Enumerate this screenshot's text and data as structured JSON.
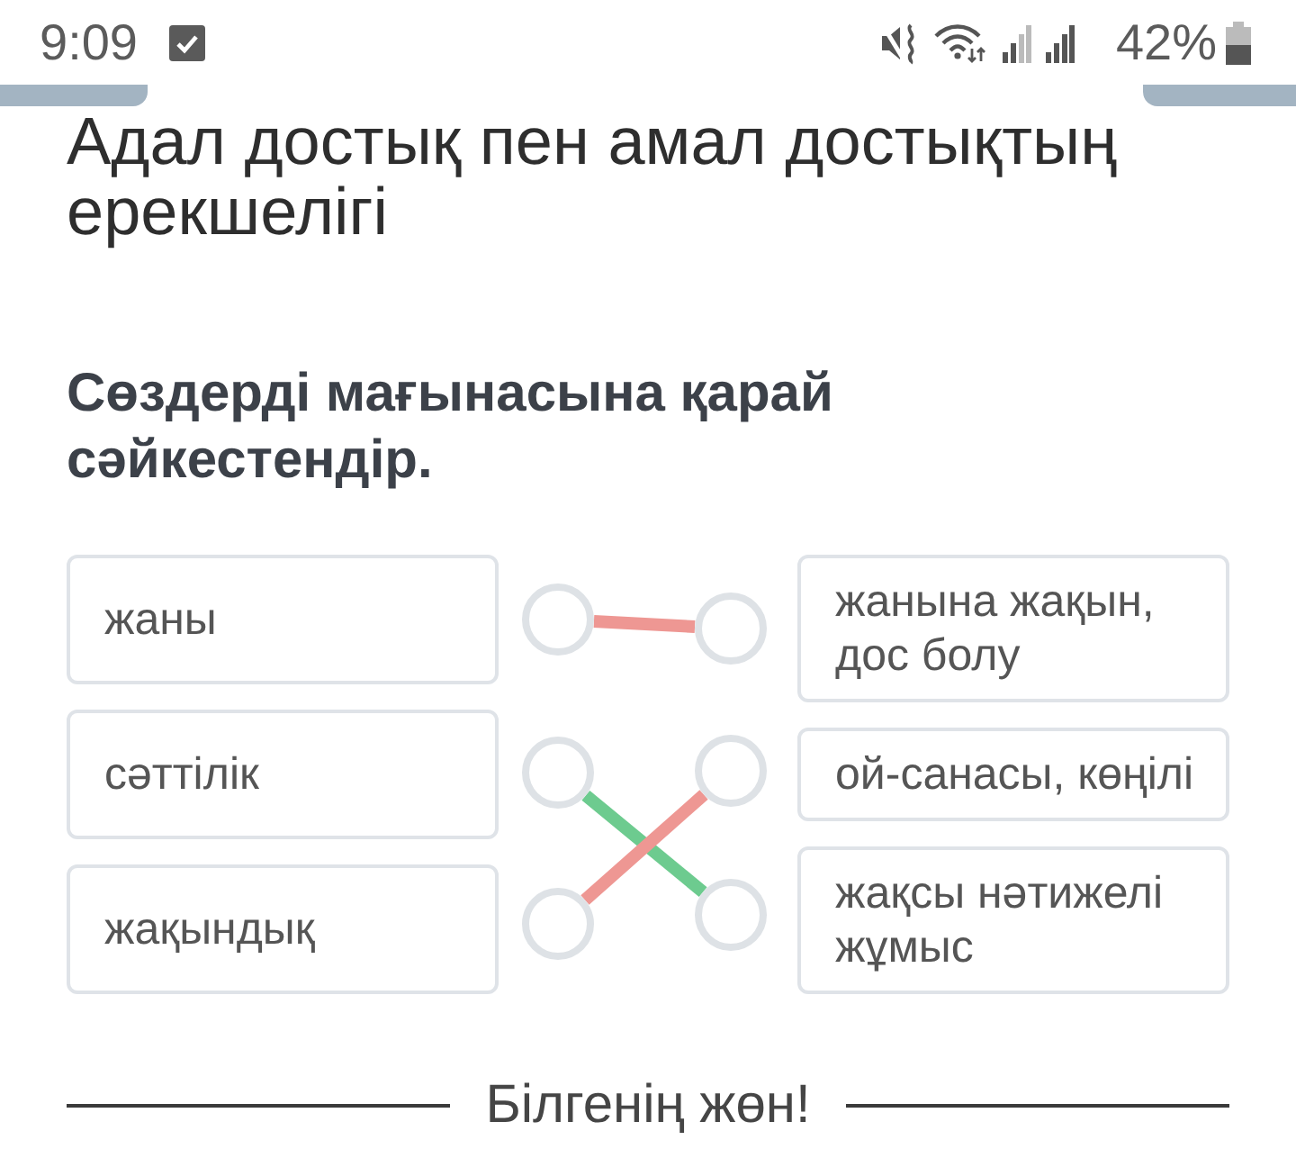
{
  "status_bar": {
    "time": "9:09",
    "battery": "42%"
  },
  "title": "Адал достық пен амал достықтың ерекшелігі",
  "question": "Сөздерді мағынасына қарай сәйкестендір.",
  "left_items": [
    {
      "text": "жаны",
      "link": {
        "color": "#ee9793",
        "to_right": [
          true,
          false,
          false
        ]
      }
    },
    {
      "text": "сәттілік",
      "link": {
        "color": "#6dcb8f",
        "to_right": [
          false,
          false,
          true
        ]
      }
    },
    {
      "text": "жақындық",
      "link": {
        "color": "#ee9793",
        "to_right": [
          false,
          true,
          false
        ]
      }
    }
  ],
  "right_items": [
    {
      "text": "жанына жақын, дос болу"
    },
    {
      "text": "ой-санасы, көңілі"
    },
    {
      "text": "жақсы нәтижелі жұмыс"
    }
  ],
  "footer": {
    "heading": "Білгенің жөн!"
  }
}
